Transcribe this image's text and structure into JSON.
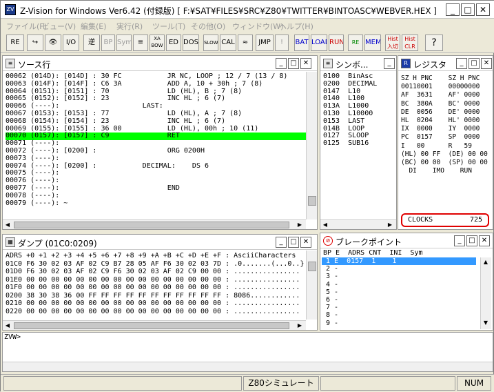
{
  "window": {
    "title": "Z-Vision for Windows Ver6.42  (付録版)  [ F:¥SAT¥FILES¥SRC¥Z80¥TWITTER¥BINTOASC¥WEBVER.HEX ]"
  },
  "menu": [
    "ファイル(F)",
    "ビュー(V)",
    "編集(E)",
    "実行(R)",
    "ツール(T)",
    "その他(O)",
    "ウィンドウ(W)",
    "ヘルプ(H)"
  ],
  "toolbar": [
    "RE SET",
    "↪",
    "👁",
    "I/O",
    "逆",
    "BP",
    "Sym",
    "≡",
    "XA BOW",
    "ED",
    "DOS",
    "SLOW",
    "CAL",
    "≈",
    "JMP",
    "!",
    "BAT",
    "LOAD",
    "RUN",
    "RE SET",
    "MEM",
    "Hist 入切",
    "Hist CLR",
    "?"
  ],
  "source": {
    "title": "ソース行",
    "lines": [
      "00062 (014D): [014D] : 30 FC           JR NC, LOOP ; 12 / 7 (13 / 8)",
      "00063 (014F): [014F] : C6 3A           ADD A, 10 + 30h ; 7 (8)",
      "00064 (0151): [0151] : 70              LD (HL), B ; 7 (8)",
      "00065 (0152): [0152] : 23              INC HL ; 6 (7)",
      "00066 (----):                    LAST:",
      "00067 (0153): [0153] : 77              LD (HL), A ; 7 (8)",
      "00068 (0154): [0154] : 23              INC HL ; 6 (7)",
      "00069 (0155): [0155] : 36 00           LD (HL), 00h ; 10 (11)",
      "00070 (0157): [0157] : C9              RET",
      "00071 (----):",
      "00072 (----): [0200] :                 ORG 0200H",
      "00073 (----):",
      "00074 (----): [0200] :           DECIMAL:    DS 6",
      "00075 (----):",
      "00076 (----):",
      "00077 (----):                          END",
      "00078 (----):",
      "00079 (----): ~"
    ],
    "highlight_index": 8
  },
  "symbols": {
    "title": "シンボ...",
    "items": [
      "0100  BinAsc",
      "0200  DECIMAL",
      "0147  L10",
      "0140  L100",
      "013A  L1000",
      "0130  L10000",
      "0153  LAST",
      "014B  LOOP",
      "0127  SLOOP",
      "0125  SUB16"
    ]
  },
  "registers": {
    "title": "レジスタ",
    "lines": [
      "SZ H PNC    SZ H PNC",
      "00110001    00000000",
      "",
      "AF  3631    AF' 0000",
      "BC  380A    BC' 0000",
      "DE  0056    DE' 0000",
      "HL  0204    HL' 0000",
      "",
      "IX  0000    IY  0000",
      "PC  0157    SP  0000",
      "I   00      R   59",
      "",
      "(HL) 00 FF  (DE) 00 00",
      "(BC) 00 00  (SP) 00 00",
      "",
      "  DI    IMO    RUN"
    ],
    "clocks_label": "CLOCKS",
    "clocks_value": "725"
  },
  "dump": {
    "title": "ダンプ (01C0:0209)",
    "lines": [
      "ADRS +0 +1 +2 +3 +4 +5 +6 +7 +8 +9 +A +B +C +D +E +F : AsciiCharacters",
      "01C0 F6 30 02 03 AF 02 C9 B7 28 05 AF F6 30 02 03 7D : .0.......(...0..}",
      "01D0 F6 30 02 03 AF 02 C9 F6 30 02 03 AF 02 C9 00 00 : ................",
      "01E0 00 00 00 00 00 00 00 00 00 00 00 00 00 00 00 00 : ................",
      "01F0 00 00 00 00 00 00 00 00 00 00 00 00 00 00 00 00 : ................",
      "0200 38 30 38 36 00 FF FF FF FF FF FF FF FF FF FF FF : 8086............",
      "0210 00 00 00 00 00 00 00 00 00 00 00 00 00 00 00 00 : ................",
      "0220 00 00 00 00 00 00 00 00 00 00 00 00 00 00 00 00 : ................"
    ]
  },
  "breakpoints": {
    "title": "ブレークポイント",
    "header": "BP E  ADRS CNT  INI  Sym",
    "lines": [
      " 1 E  0157  1    1",
      " 2 -",
      " 3 -",
      " 4 -",
      " 5 -",
      " 6 -",
      " 7 -",
      " 8 -",
      " 9 -"
    ]
  },
  "console": {
    "prompt": "ZVW>"
  },
  "statusbar": {
    "mode": "Z80シミュレート",
    "num": "NUM"
  },
  "colors": {
    "highlight": "#00ff00",
    "selection": "#3399ff",
    "clocks_border": "#e00000"
  }
}
